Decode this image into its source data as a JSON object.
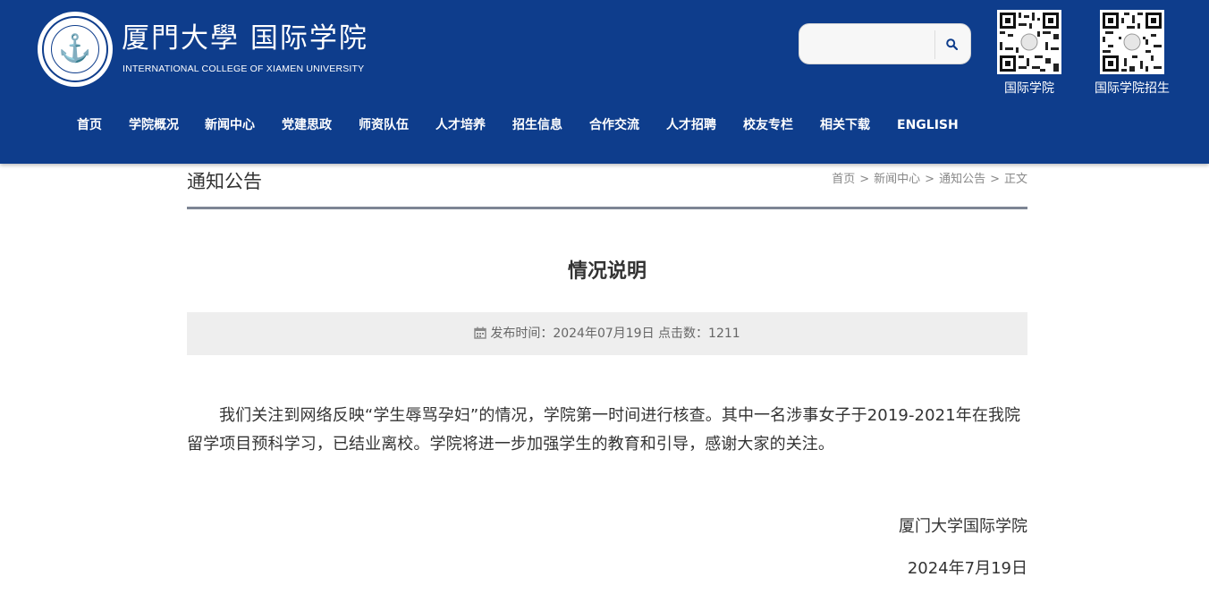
{
  "header": {
    "logo_cn": "厦門大學 国际学院",
    "logo_en": "INTERNATIONAL COLLEGE OF XIAMEN UNIVERSITY",
    "search": {
      "placeholder": "",
      "value": ""
    },
    "qr_codes": [
      {
        "label": "国际学院"
      },
      {
        "label": "国际学院招生"
      }
    ],
    "nav": [
      "首页",
      "学院概况",
      "新闻中心",
      "党建思政",
      "师资队伍",
      "人才培养",
      "招生信息",
      "合作交流",
      "人才招聘",
      "校友专栏",
      "相关下载",
      "ENGLISH"
    ]
  },
  "page": {
    "section_title": "通知公告",
    "breadcrumb": [
      "首页",
      "新闻中心",
      "通知公告",
      "正文"
    ],
    "breadcrumb_separator": ">",
    "article": {
      "title": "情况说明",
      "meta": "发布时间：2024年07月19日 点击数：1211",
      "body": "我们关注到网络反映“学生辱骂孕妇”的情况，学院第一时间进行核查。其中一名涉事女子于2019-2021年在我院留学项目预科学习，已结业离校。学院将进一步加强学生的教育和引导，感谢大家的关注。",
      "signature_org": "厦门大学国际学院",
      "signature_date": "2024年7月19日"
    }
  },
  "colors": {
    "header_bg": "#0e3d8c",
    "title_rule": "#7d8594",
    "meta_bg": "#eeeeee"
  },
  "icons": {
    "search": "search-icon",
    "calendar": "calendar-icon",
    "logo": "university-emblem"
  }
}
